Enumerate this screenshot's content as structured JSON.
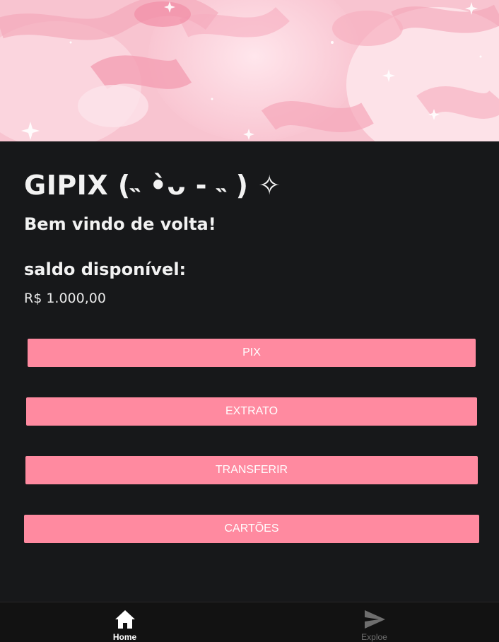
{
  "app": {
    "title": "GIPIX (˵ •̀ᴗ - ˵ ) ✧",
    "welcome": "Bem vindo de volta!"
  },
  "balance": {
    "label": "saldo disponível:",
    "value": "R$ 1.000,00"
  },
  "actions": {
    "pix": "PIX",
    "extrato": "EXTRATO",
    "transferir": "TRANSFERIR",
    "cartoes": "CARTÕES"
  },
  "tabs": [
    {
      "label": "Home",
      "icon": "home-icon",
      "active": true
    },
    {
      "label": "Exploe",
      "icon": "send-icon",
      "active": false
    }
  ],
  "colors": {
    "background": "#17181a",
    "button": "#ff8aa0",
    "button_text": "#ffffff",
    "text": "#f2f2f2",
    "tabbar": "#121212",
    "tab_inactive": "#6e6e6e",
    "banner_pink": "#f7b8c6"
  }
}
